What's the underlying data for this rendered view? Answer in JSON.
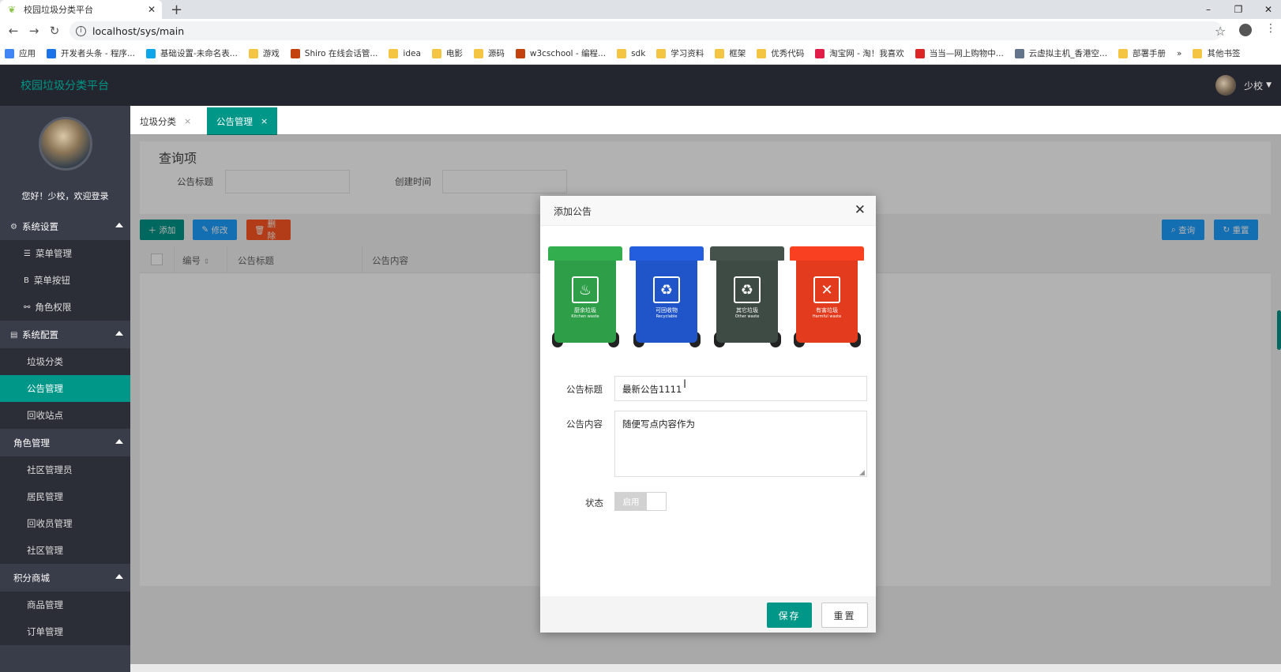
{
  "browser": {
    "tab_title": "校园垃圾分类平台",
    "tab_close": "✕",
    "new_tab": "+",
    "url": "localhost/sys/main",
    "window_controls": [
      "–",
      "❐",
      "✕"
    ],
    "bookmarks": [
      {
        "label": "应用",
        "color": "#4285f4"
      },
      {
        "label": "开发者头条 - 程序...",
        "color": "#1a73e8"
      },
      {
        "label": "基础设置-未命名表...",
        "color": "#0ea5e9"
      },
      {
        "label": "游戏",
        "color": "#f4c542"
      },
      {
        "label": "Shiro 在线会话管...",
        "color": "#c2410c"
      },
      {
        "label": "idea",
        "color": "#f4c542"
      },
      {
        "label": "电影",
        "color": "#f4c542"
      },
      {
        "label": "源码",
        "color": "#f4c542"
      },
      {
        "label": "w3cschool - 编程...",
        "color": "#c2410c"
      },
      {
        "label": "sdk",
        "color": "#f4c542"
      },
      {
        "label": "学习资料",
        "color": "#f4c542"
      },
      {
        "label": "框架",
        "color": "#f4c542"
      },
      {
        "label": "优秀代码",
        "color": "#f4c542"
      },
      {
        "label": "淘宝网 - 淘！我喜欢",
        "color": "#e11d48"
      },
      {
        "label": "当当—网上购物中...",
        "color": "#dc2626"
      },
      {
        "label": "云虚拟主机_香港空...",
        "color": "#64748b"
      },
      {
        "label": "部署手册",
        "color": "#f4c542"
      }
    ],
    "bookmarks_overflow": "»",
    "other_bookmarks": "其他书签"
  },
  "header": {
    "brand": "校园垃圾分类平台",
    "username": "少校"
  },
  "sidebar": {
    "welcome": "您好！少校，欢迎登录",
    "groups": [
      {
        "label": "系统设置",
        "icon": "⚙",
        "items": [
          {
            "label": "菜单管理",
            "icon": "☰"
          },
          {
            "label": "菜单按钮",
            "icon": "B"
          },
          {
            "label": "角色权限",
            "icon": "⚯"
          }
        ]
      },
      {
        "label": "系统配置",
        "icon": "▤",
        "items": [
          {
            "label": "垃圾分类"
          },
          {
            "label": "公告管理",
            "active": true
          },
          {
            "label": "回收站点"
          }
        ]
      },
      {
        "label": "角色管理",
        "items": [
          {
            "label": "社区管理员"
          },
          {
            "label": "居民管理"
          },
          {
            "label": "回收员管理"
          },
          {
            "label": "社区管理"
          }
        ]
      },
      {
        "label": "积分商城",
        "items": [
          {
            "label": "商品管理"
          },
          {
            "label": "订单管理"
          }
        ]
      }
    ]
  },
  "page_tabs": [
    {
      "label": "垃圾分类",
      "close": "×"
    },
    {
      "label": "公告管理",
      "close": "×",
      "active": true
    }
  ],
  "query": {
    "title": "查询项",
    "fields": [
      "公告标题",
      "创建时间"
    ]
  },
  "toolbar": {
    "add": "添加",
    "edit": "修改",
    "delete": "删除",
    "search": "查询",
    "reset": "重置"
  },
  "table": {
    "columns": [
      "编号",
      "公告标题",
      "公告内容"
    ]
  },
  "modal": {
    "title": "添加公告",
    "close": "✕",
    "bins": [
      {
        "label": "厨余垃圾",
        "en": "Kitchen waste",
        "color": "#2e9e48",
        "symbol": "♨"
      },
      {
        "label": "可回收物",
        "en": "Recyclable",
        "color": "#1f55c9",
        "symbol": "♻"
      },
      {
        "label": "其它垃圾",
        "en": "Other waste",
        "color": "#3e4b44",
        "symbol": "♻"
      },
      {
        "label": "有害垃圾",
        "en": "Harmful waste",
        "color": "#e23b1e",
        "symbol": "✕"
      }
    ],
    "title_label": "公告标题",
    "title_value": "最新公告1111",
    "content_label": "公告内容",
    "content_value": "随便写点内容作为",
    "status_label": "状态",
    "status_value": "启用",
    "save": "保存",
    "reset": "重置"
  }
}
